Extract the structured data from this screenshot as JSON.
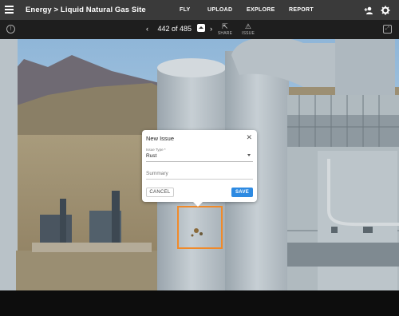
{
  "header": {
    "breadcrumb": "Energy > Liquid Natural Gas Site",
    "nav": [
      "FLY",
      "UPLOAD",
      "EXPLORE",
      "REPORT"
    ]
  },
  "toolbar": {
    "prev": "‹",
    "next": "›",
    "page_count": "442 of 485",
    "share_label": "SHARE",
    "issue_label": "ISSUE"
  },
  "dialog": {
    "title": "New Issue",
    "issue_type_label": "Issue Type *",
    "issue_type_value": "Rust",
    "summary_placeholder": "Summary",
    "cancel_label": "CANCEL",
    "save_label": "SAVE"
  },
  "colors": {
    "topbar": "#3a3a3a",
    "accent_save": "#2d8ae2",
    "marker": "#f08a2a"
  }
}
